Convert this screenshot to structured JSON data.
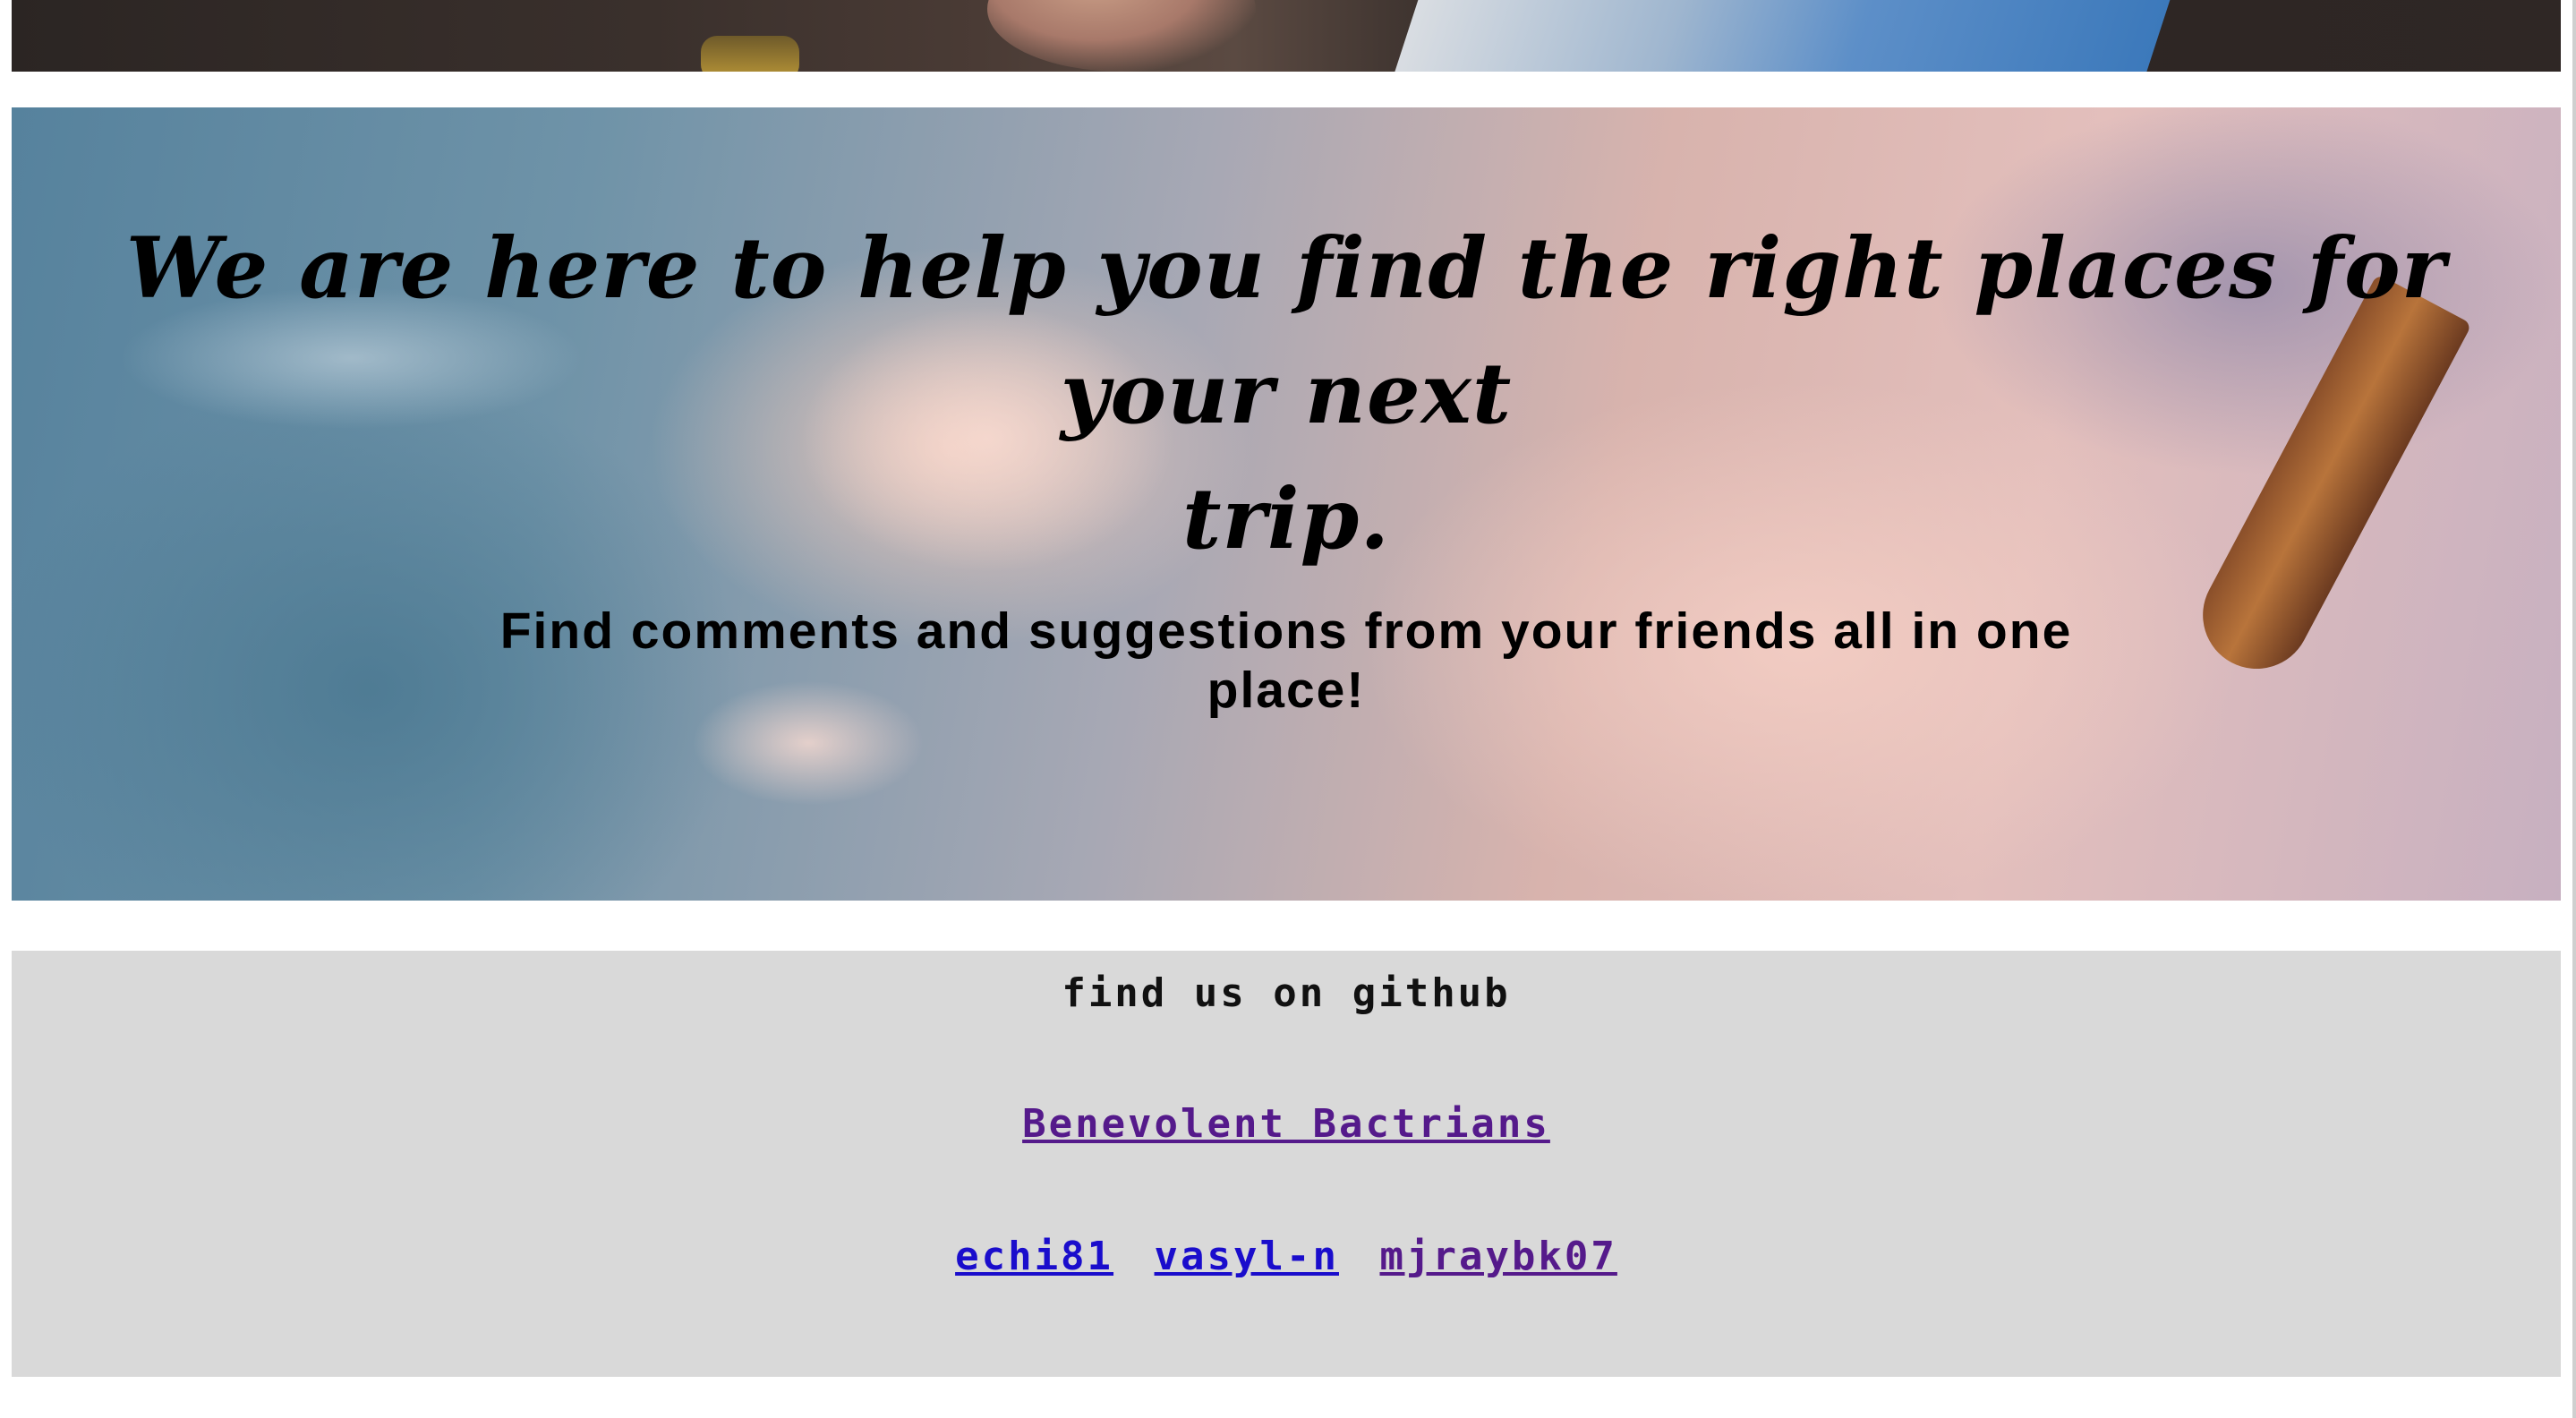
{
  "hero": {
    "title_line1": "We are here to help you find the right places for your next",
    "title_line2": "trip.",
    "subtitle_line1": "Find comments and suggestions from your friends all in one",
    "subtitle_line2": "place!"
  },
  "footer": {
    "heading": "find us on github",
    "team_link": "Benevolent Bactrians",
    "members": [
      {
        "label": "echi81",
        "visited": false
      },
      {
        "label": "vasyl-n",
        "visited": false
      },
      {
        "label": "mjraybk07",
        "visited": true
      }
    ]
  },
  "colors": {
    "link_unvisited": "#1a0dcc",
    "link_visited": "#551a8b",
    "footer_bg": "#d9d9d9"
  }
}
